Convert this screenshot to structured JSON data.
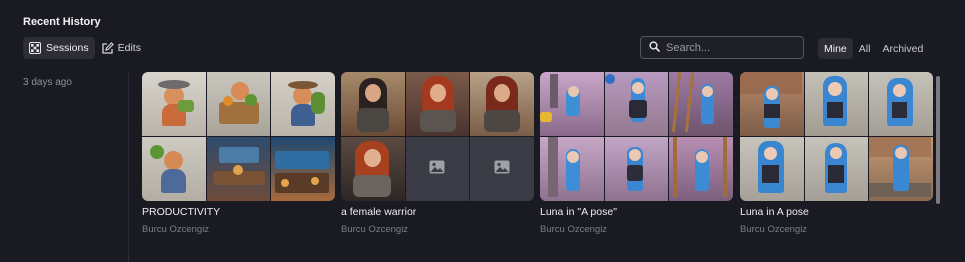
{
  "header": {
    "title": "Recent History"
  },
  "mode_tabs": [
    {
      "label": "Sessions",
      "icon": "grid-icon",
      "active": true
    },
    {
      "label": "Edits",
      "icon": "edit-icon",
      "active": false
    }
  ],
  "search": {
    "placeholder": "Search..."
  },
  "filters": [
    {
      "label": "Mine",
      "active": true
    },
    {
      "label": "All",
      "active": false
    },
    {
      "label": "Archived",
      "active": false
    }
  ],
  "date_group": {
    "label": "3 days ago"
  },
  "sessions": [
    {
      "title": "PRODUCTIVITY",
      "author": "Burcu Ozcengiz"
    },
    {
      "title": "a female warrior",
      "author": "Burcu Ozcengiz"
    },
    {
      "title": "Luna in \"A pose\"",
      "author": "Burcu Ozcengiz"
    },
    {
      "title": "Luna in A pose",
      "author": "Burcu Ozcengiz"
    }
  ],
  "colors": {
    "background": "#191a22",
    "surface": "#2c2d37",
    "muted_text": "#7d7e86"
  }
}
